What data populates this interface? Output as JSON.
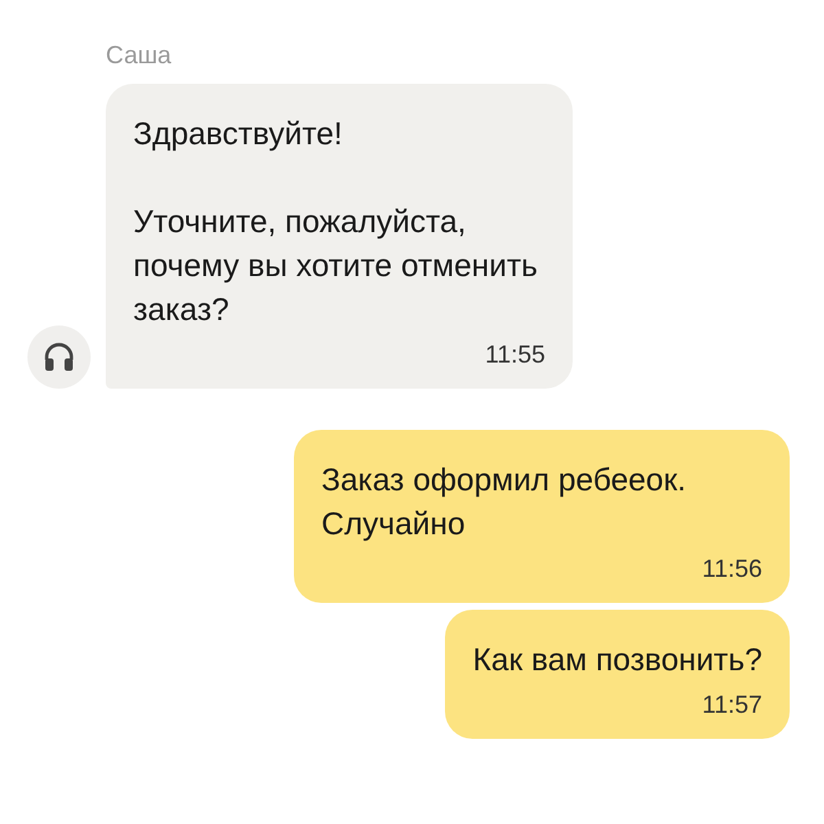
{
  "messages": [
    {
      "kind": "incoming",
      "sender": "Саша",
      "text": "Здравствуйте!\n\nУточните, пожалуйста, почему вы хотите отменить заказ?",
      "time": "11:55"
    },
    {
      "kind": "outgoing",
      "text": "Заказ оформил ребееок. Случайно",
      "time": "11:56"
    },
    {
      "kind": "outgoing",
      "text": "Как вам позвонить?",
      "time": "11:57"
    }
  ]
}
